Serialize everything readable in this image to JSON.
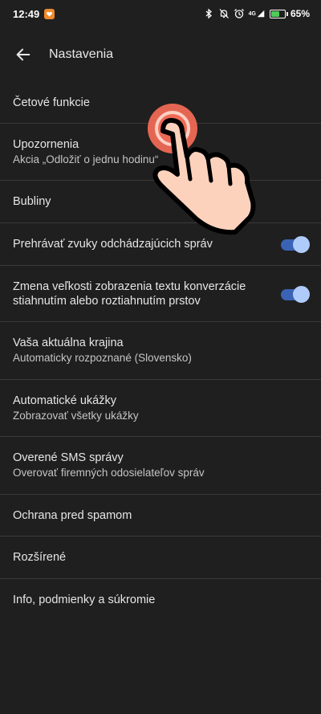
{
  "status_bar": {
    "time": "12:49",
    "network_label": "4G",
    "battery_percent": "65%",
    "battery_level": 0.65,
    "icons": [
      "app-notification-icon",
      "bluetooth-icon",
      "mute-icon",
      "alarm-icon",
      "signal-icon",
      "battery-icon"
    ]
  },
  "app_bar": {
    "title": "Nastavenia",
    "back_icon": "arrow-back-icon"
  },
  "settings": {
    "chat_features": {
      "title": "Četové funkcie"
    },
    "notifications": {
      "title": "Upozornenia",
      "subtitle": "Akcia „Odložiť o jednu hodinu“"
    },
    "bubbles": {
      "title": "Bubliny"
    },
    "outgoing_sounds": {
      "title": "Prehrávať zvuky odchádzajúcich správ",
      "enabled": true
    },
    "pinch_zoom": {
      "title": "Zmena veľkosti zobrazenia textu konverzácie stiahnutím alebo roztiahnutím prstov",
      "enabled": true
    },
    "country": {
      "title": "Vaša aktuálna krajina",
      "subtitle": "Automaticky rozpoznané (Slovensko)"
    },
    "previews": {
      "title": "Automatické ukážky",
      "subtitle": "Zobrazovať všetky ukážky"
    },
    "verified_sms": {
      "title": "Overené SMS správy",
      "subtitle": "Overovať firemných odosielateľov správ"
    },
    "spam_protection": {
      "title": "Ochrana pred spamom"
    },
    "advanced": {
      "title": "Rozšírené"
    },
    "about": {
      "title": "Info, podmienky a súkromie"
    }
  },
  "overlay": {
    "tap_indicator_color": "#ef6a55",
    "hand_fill_color": "#fdd2bd",
    "icon": "tap-hand-icon"
  },
  "colors": {
    "background": "#1f1f1f",
    "divider": "#3a3a3a",
    "toggle_track": "#3a63b6",
    "toggle_thumb": "#aecbfa",
    "battery_fill": "#4ecb58"
  }
}
